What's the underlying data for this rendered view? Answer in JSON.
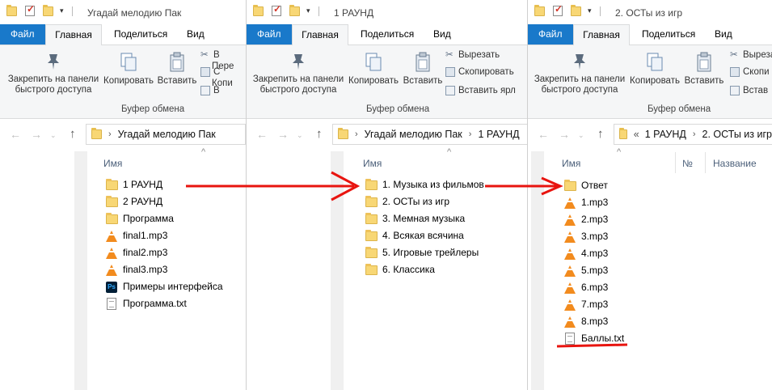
{
  "ribbon_common": {
    "pin_label_line1": "Закрепить на панели",
    "pin_label_line2": "быстрого доступа",
    "copy_label": "Копировать",
    "paste_label": "Вставить",
    "group_label": "Буфер обмена"
  },
  "tabs": {
    "file": "Файл",
    "home": "Главная",
    "share": "Поделиться",
    "view": "Вид"
  },
  "window1": {
    "title": "Угадай мелодию Пак",
    "ribbon_small": [
      "В",
      "С",
      "В"
    ],
    "ribbon_small_partial": [
      "Пере",
      "Копи"
    ],
    "address": [
      "Угадай мелодию Пак"
    ],
    "column_name": "Имя",
    "items": [
      {
        "name": "1 РАУНД",
        "icon": "folder-icon"
      },
      {
        "name": "2 РАУНД",
        "icon": "folder-icon"
      },
      {
        "name": "Программа",
        "icon": "folder-icon"
      },
      {
        "name": "final1.mp3",
        "icon": "vlc-icon"
      },
      {
        "name": "final2.mp3",
        "icon": "vlc-icon"
      },
      {
        "name": "final3.mp3",
        "icon": "vlc-icon"
      },
      {
        "name": "Примеры интерфейса",
        "icon": "photoshop-icon"
      },
      {
        "name": "Программа.txt",
        "icon": "text-file-icon"
      }
    ]
  },
  "window2": {
    "title": "1 РАУНД",
    "ribbon_small": [
      "Вырезать",
      "Скопировать",
      "Вставить ярл"
    ],
    "address": [
      "Угадай мелодию Пак",
      "1 РАУНД"
    ],
    "column_name": "Имя",
    "items": [
      {
        "name": "1. Музыка из фильмов",
        "icon": "folder-icon"
      },
      {
        "name": "2. ОСТы из игр",
        "icon": "folder-icon"
      },
      {
        "name": "3. Мемная музыка",
        "icon": "folder-icon"
      },
      {
        "name": "4. Всякая всячина",
        "icon": "folder-icon"
      },
      {
        "name": "5. Игровые трейлеры",
        "icon": "folder-icon"
      },
      {
        "name": "6. Классика",
        "icon": "folder-icon"
      }
    ]
  },
  "window3": {
    "title": "2. ОСТы из игр",
    "ribbon_small": [
      "Выреза",
      "Скопи",
      "Встав"
    ],
    "address_prefix": "«",
    "address": [
      "1 РАУНД",
      "2. ОСТы из игр"
    ],
    "column_name": "Имя",
    "column_num": "№",
    "column_title": "Название",
    "items": [
      {
        "name": "Ответ",
        "icon": "folder-icon"
      },
      {
        "name": "1.mp3",
        "icon": "vlc-icon"
      },
      {
        "name": "2.mp3",
        "icon": "vlc-icon"
      },
      {
        "name": "3.mp3",
        "icon": "vlc-icon"
      },
      {
        "name": "4.mp3",
        "icon": "vlc-icon"
      },
      {
        "name": "5.mp3",
        "icon": "vlc-icon"
      },
      {
        "name": "6.mp3",
        "icon": "vlc-icon"
      },
      {
        "name": "7.mp3",
        "icon": "vlc-icon"
      },
      {
        "name": "8.mp3",
        "icon": "vlc-icon"
      },
      {
        "name": "Баллы.txt",
        "icon": "text-file-icon"
      }
    ]
  },
  "colors": {
    "file_tab": "#1979ca",
    "annotation": "#e8140f",
    "folder": "#f8d775",
    "vlc": "#f28b1e"
  }
}
